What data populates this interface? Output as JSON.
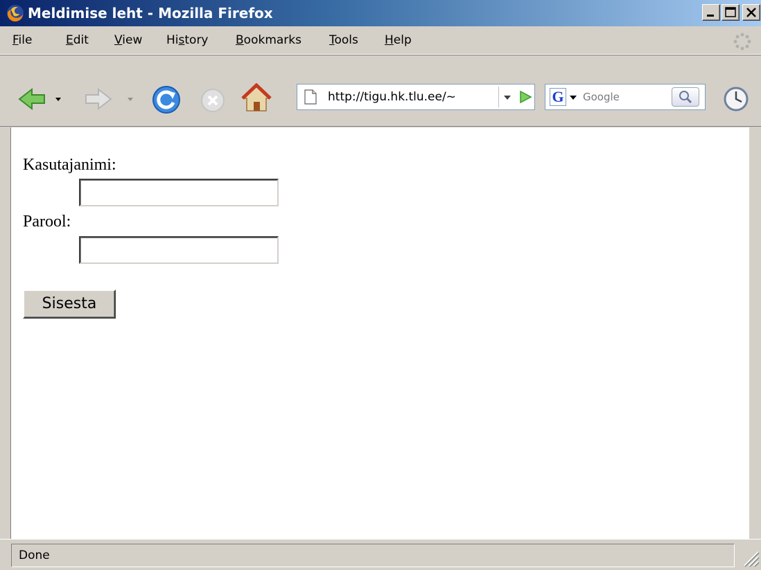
{
  "window": {
    "title": "Meldimise leht - Mozilla Firefox"
  },
  "menu": {
    "items": [
      {
        "pre": "",
        "acc": "F",
        "post": "ile"
      },
      {
        "pre": "",
        "acc": "E",
        "post": "dit"
      },
      {
        "pre": "",
        "acc": "V",
        "post": "iew"
      },
      {
        "pre": "Hi",
        "acc": "s",
        "post": "tory"
      },
      {
        "pre": "",
        "acc": "B",
        "post": "ookmarks"
      },
      {
        "pre": "",
        "acc": "T",
        "post": "ools"
      },
      {
        "pre": "",
        "acc": "H",
        "post": "elp"
      }
    ]
  },
  "toolbar": {
    "url": "http://tigu.hk.tlu.ee/~",
    "search_placeholder": "Google",
    "search_engine_letter": "G"
  },
  "form": {
    "username_label": "Kasutajanimi:",
    "username_value": "",
    "password_label": "Parool:",
    "password_value": "",
    "submit_label": "Sisesta"
  },
  "status": {
    "text": "Done"
  },
  "icons": {
    "app": "firefox-icon",
    "back": "back-arrow-icon",
    "forward": "forward-arrow-icon",
    "reload": "reload-icon",
    "stop": "stop-icon",
    "home": "home-icon",
    "page": "page-icon",
    "go": "go-arrow-icon",
    "search": "magnifier-icon",
    "history": "clock-icon",
    "throbber": "throbber-icon"
  }
}
